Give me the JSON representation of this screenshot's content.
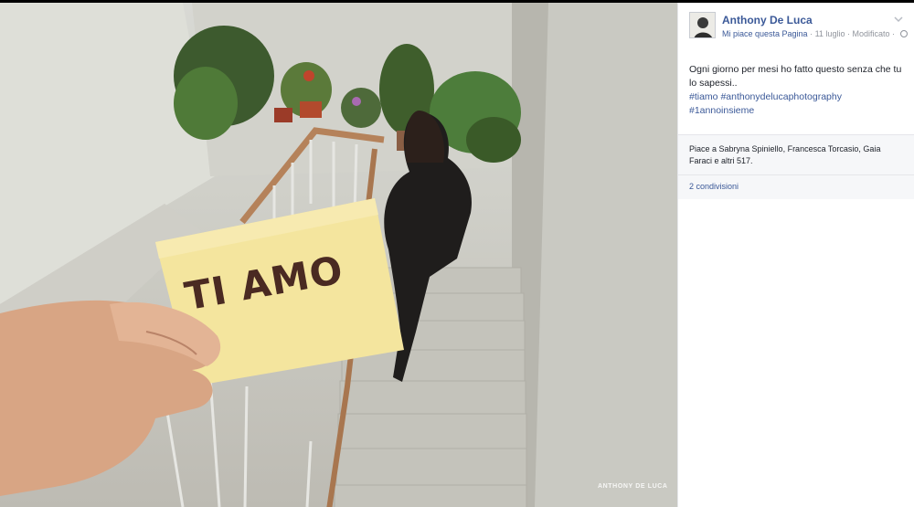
{
  "photo": {
    "note_text": "TI AMO",
    "watermark": "ANTHONY DE LUCA"
  },
  "post": {
    "author": "Anthony De Luca",
    "like_page": "Mi piace questa Pagina",
    "date": "11 luglio",
    "edited": "Modificato",
    "separator": "·",
    "text": "Ogni giorno per mesi ho fatto questo senza che tu lo sapessi..",
    "hashtags": [
      "#tiamo",
      "#anthonydelucaphotography",
      "#1annoinsieme"
    ],
    "likes": "Piace a Sabryna Spiniello, Francesca Torcasio, Gaia Faraci e altri 517.",
    "shares": "2 condivisioni"
  },
  "colors": {
    "link": "#3b5998",
    "meta": "#90949c",
    "panel_bg": "#f6f7f9"
  },
  "icons": {
    "menu": "chevron-down-icon",
    "audience": "globe-icon"
  }
}
